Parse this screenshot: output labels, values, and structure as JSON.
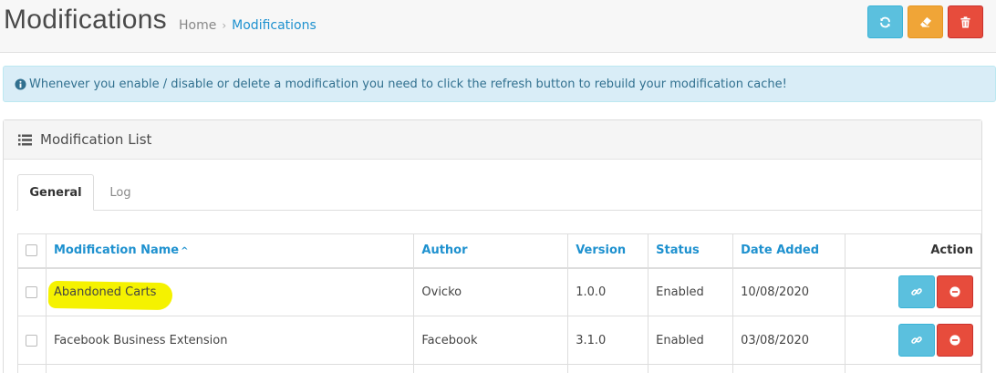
{
  "header": {
    "title": "Modifications",
    "breadcrumb": [
      {
        "label": "Home"
      },
      {
        "label": "Modifications"
      }
    ],
    "breadcrumb_separator": "›",
    "buttons": [
      {
        "name": "refresh",
        "icon": "refresh-icon",
        "color": "#5bc0de"
      },
      {
        "name": "clear",
        "icon": "eraser-icon",
        "color": "#f0a537"
      },
      {
        "name": "delete",
        "icon": "trash-icon",
        "color": "#e74c3c"
      }
    ]
  },
  "alert": {
    "icon": "info-circle-icon",
    "text": "Whenever you enable / disable or delete a modification you need to click the refresh button to rebuild your modification cache!"
  },
  "panel": {
    "title": "Modification List",
    "icon": "list-icon",
    "tabs": [
      {
        "label": "General",
        "active": true
      },
      {
        "label": "Log",
        "active": false
      }
    ]
  },
  "table": {
    "columns": {
      "name": "Modification Name",
      "name_sort": "^",
      "author": "Author",
      "version": "Version",
      "status": "Status",
      "date_added": "Date Added",
      "action": "Action"
    },
    "rows": [
      {
        "name": "Abandoned Carts",
        "author": "Ovicko",
        "version": "1.0.0",
        "status": "Enabled",
        "date_added": "10/08/2020",
        "highlighted": true
      },
      {
        "name": "Facebook Business Extension",
        "author": "Facebook",
        "version": "3.1.0",
        "status": "Enabled",
        "date_added": "03/08/2020",
        "highlighted": false
      }
    ]
  },
  "colors": {
    "accent": "#1e91cf",
    "info": "#5bc0de",
    "warning": "#f0a537",
    "danger": "#e74c3c",
    "highlight": "#f5f200"
  }
}
